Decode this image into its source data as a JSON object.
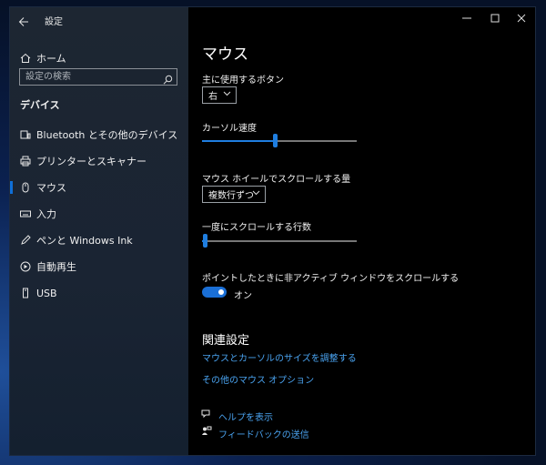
{
  "window": {
    "title": "設定",
    "back_icon": "back-arrow-icon",
    "minimize_icon": "minimize-icon",
    "maximize_icon": "maximize-icon",
    "close_icon": "close-icon"
  },
  "sidebar": {
    "home_label": "ホーム",
    "search_placeholder": "設定の検索",
    "section_title": "デバイス",
    "items": [
      {
        "label": "Bluetooth とその他のデバイス",
        "icon": "bluetooth-devices-icon"
      },
      {
        "label": "プリンターとスキャナー",
        "icon": "printer-icon"
      },
      {
        "label": "マウス",
        "icon": "mouse-icon"
      },
      {
        "label": "入力",
        "icon": "keyboard-icon"
      },
      {
        "label": "ペンと Windows Ink",
        "icon": "pen-icon"
      },
      {
        "label": "自動再生",
        "icon": "autoplay-icon"
      },
      {
        "label": "USB",
        "icon": "usb-icon"
      }
    ],
    "selected_index": 2
  },
  "main": {
    "title": "マウス",
    "primary_button_label": "主に使用するボタン",
    "primary_button_value": "右",
    "cursor_speed_label": "カーソル速度",
    "cursor_speed_fraction": 0.47,
    "wheel_scroll_label": "マウス ホイールでスクロールする量",
    "wheel_scroll_value": "複数行ずつ",
    "lines_label": "一度にスクロールする行数",
    "lines_fraction": 0.02,
    "inactive_scroll_label": "ポイントしたときに非アクティブ ウィンドウをスクロールする",
    "inactive_scroll_state": "オン",
    "related_title": "関連設定",
    "related_links": [
      "マウスとカーソルのサイズを調整する",
      "その他のマウス オプション"
    ],
    "help_link": "ヘルプを表示",
    "feedback_link": "フィードバックの送信"
  }
}
